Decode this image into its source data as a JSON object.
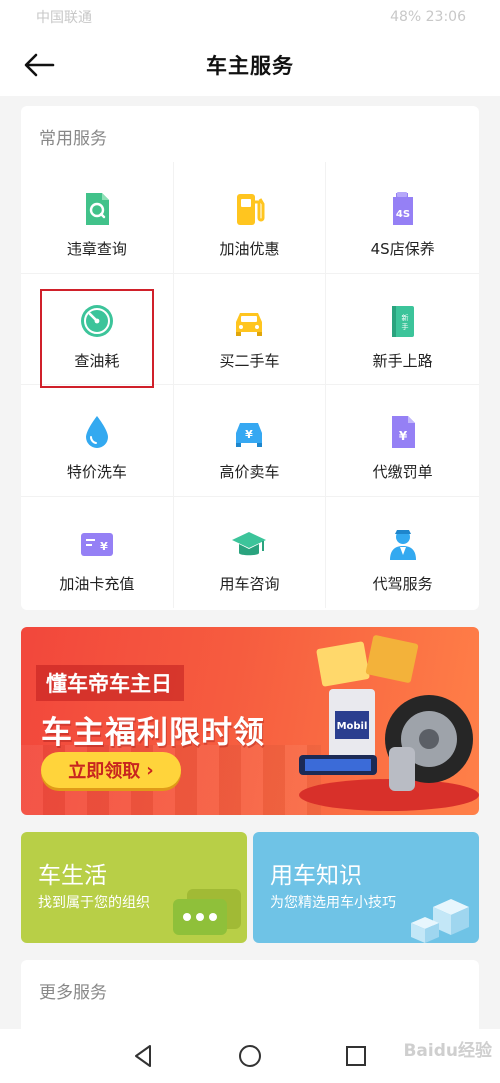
{
  "status_bar": {
    "carrier": "中国联通 ",
    "right": "48%  23:06"
  },
  "header": {
    "title": "车主服务"
  },
  "common_services": {
    "title": "常用服务",
    "items": [
      {
        "label": "违章查询",
        "icon": "violation-query-icon"
      },
      {
        "label": "加油优惠",
        "icon": "fuel-pump-icon"
      },
      {
        "label": "4S店保养",
        "icon": "maintenance-icon"
      },
      {
        "label": "查油耗",
        "icon": "fuel-gauge-icon"
      },
      {
        "label": "买二手车",
        "icon": "used-car-icon"
      },
      {
        "label": "新手上路",
        "icon": "novice-book-icon"
      },
      {
        "label": "特价洗车",
        "icon": "water-drop-icon"
      },
      {
        "label": "高价卖车",
        "icon": "sell-car-icon"
      },
      {
        "label": "代缴罚单",
        "icon": "pay-fine-icon"
      },
      {
        "label": "加油卡充值",
        "icon": "fuel-card-icon"
      },
      {
        "label": "用车咨询",
        "icon": "graduation-cap-icon"
      },
      {
        "label": "代驾服务",
        "icon": "driver-icon"
      }
    ]
  },
  "banner": {
    "subtitle": "懂车帝车主日",
    "headline": "车主福利限时领",
    "button_label": "立即领取",
    "art_text": "Mobil"
  },
  "tiles": {
    "left": {
      "title": "车生活",
      "subtitle": "找到属于您的组织"
    },
    "right": {
      "title": "用车知识",
      "subtitle": "为您精选用车小技巧"
    }
  },
  "more_services": {
    "title": "更多服务"
  },
  "watermark": "Baidu经验",
  "colors": {
    "accent_red": "#d0202a",
    "tile_green": "#b8cf47",
    "tile_blue": "#6fc3e6",
    "banner_red": "#f2473c"
  }
}
